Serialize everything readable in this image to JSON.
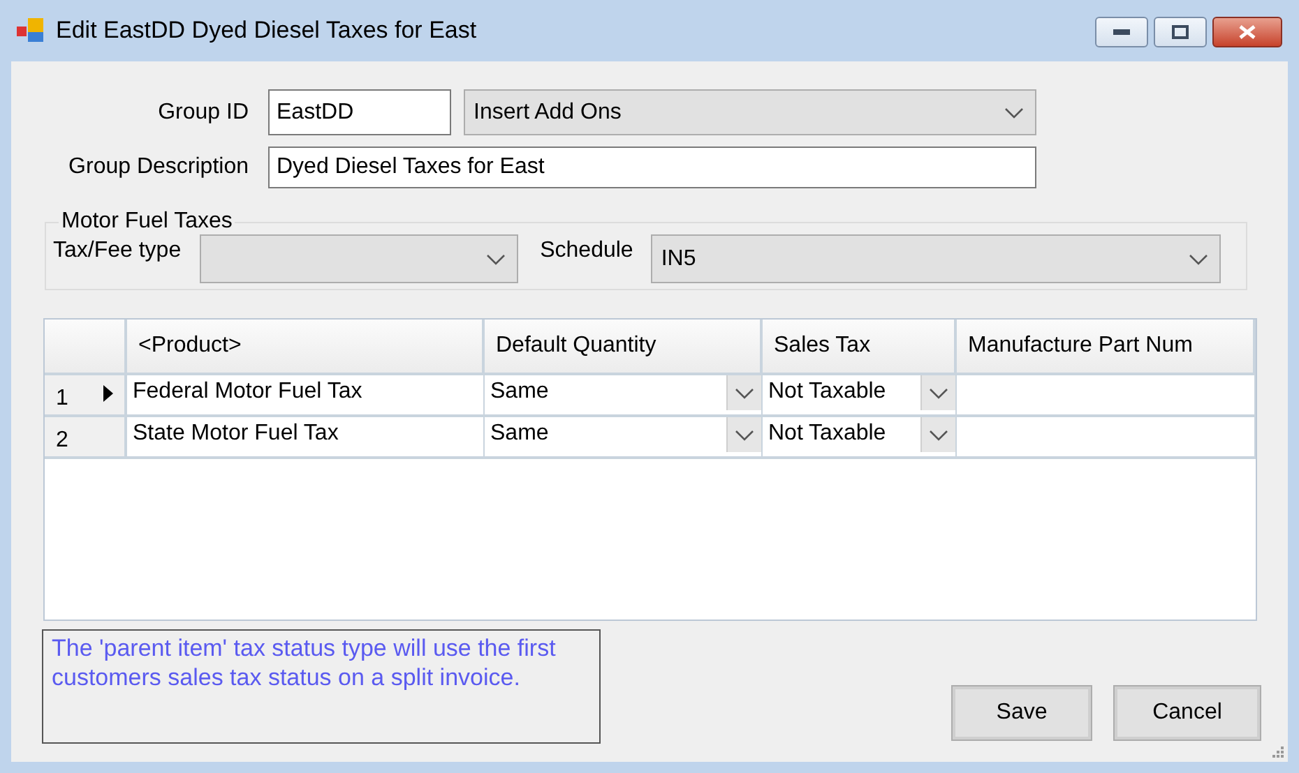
{
  "window": {
    "title": "Edit EastDD Dyed Diesel Taxes for East"
  },
  "group_id": {
    "label": "Group ID",
    "value": "EastDD"
  },
  "add_on_type": {
    "value": "Insert Add Ons"
  },
  "group_description": {
    "label": "Group Description",
    "value": "Dyed Diesel Taxes for East"
  },
  "motor_fuel_taxes": {
    "title": "Motor Fuel Taxes",
    "tax_fee_type": {
      "label": "Tax/Fee type"
    },
    "schedule": {
      "label": "Schedule",
      "value": "IN5"
    }
  },
  "grid": {
    "columns": [
      "<Product>",
      "Default Quantity",
      "Sales Tax",
      "Manufacture Part Num"
    ],
    "rows": [
      {
        "number": "1",
        "selected": true,
        "product": "Federal Motor Fuel Tax",
        "default_quantity": "Same",
        "sales_tax": "Not Taxable"
      },
      {
        "number": "2",
        "selected": false,
        "product": "State Motor Fuel Tax",
        "default_quantity": "Same",
        "sales_tax": "Not Taxable"
      }
    ]
  },
  "note": "The 'parent item' tax status type will use the first customers sales tax status on a split invoice.",
  "buttons": [
    "Save",
    "Cancel"
  ]
}
